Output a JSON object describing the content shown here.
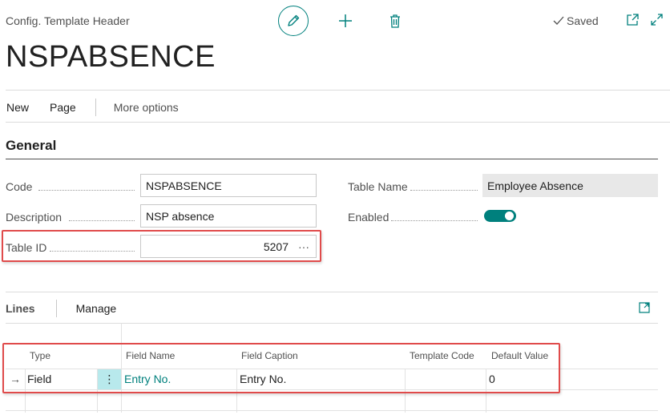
{
  "header": {
    "caption": "Config. Template Header",
    "title": "NSPABSENCE",
    "status": "Saved"
  },
  "actionbar": {
    "new_label": "New",
    "page_label": "Page",
    "more_label": "More options"
  },
  "general": {
    "section_title": "General",
    "code_label": "Code",
    "code_value": "NSPABSENCE",
    "description_label": "Description",
    "description_value": "NSP absence",
    "table_id_label": "Table ID",
    "table_id_value": "5207",
    "table_id_lookup": "···",
    "table_name_label": "Table Name",
    "table_name_value": "Employee Absence",
    "enabled_label": "Enabled",
    "enabled_value": true
  },
  "lines": {
    "title": "Lines",
    "manage_label": "Manage",
    "columns": [
      "Type",
      "Field Name",
      "Field Caption",
      "Template Code",
      "Default Value"
    ],
    "rows": [
      {
        "indicator": "→",
        "menu": "⋮",
        "type": "Field",
        "field_name": "Entry No.",
        "field_caption": "Entry No.",
        "template_code": "",
        "default_value": "0"
      }
    ]
  },
  "colors": {
    "accent": "#00807d",
    "highlight": "#e04b4b",
    "row_menu": "#b8e9ec"
  },
  "icons": [
    "edit-icon",
    "plus-icon",
    "trash-icon",
    "checkmark-icon",
    "open-in-new-window-icon",
    "expand-icon",
    "row-arrow-icon",
    "row-menu-icon"
  ]
}
